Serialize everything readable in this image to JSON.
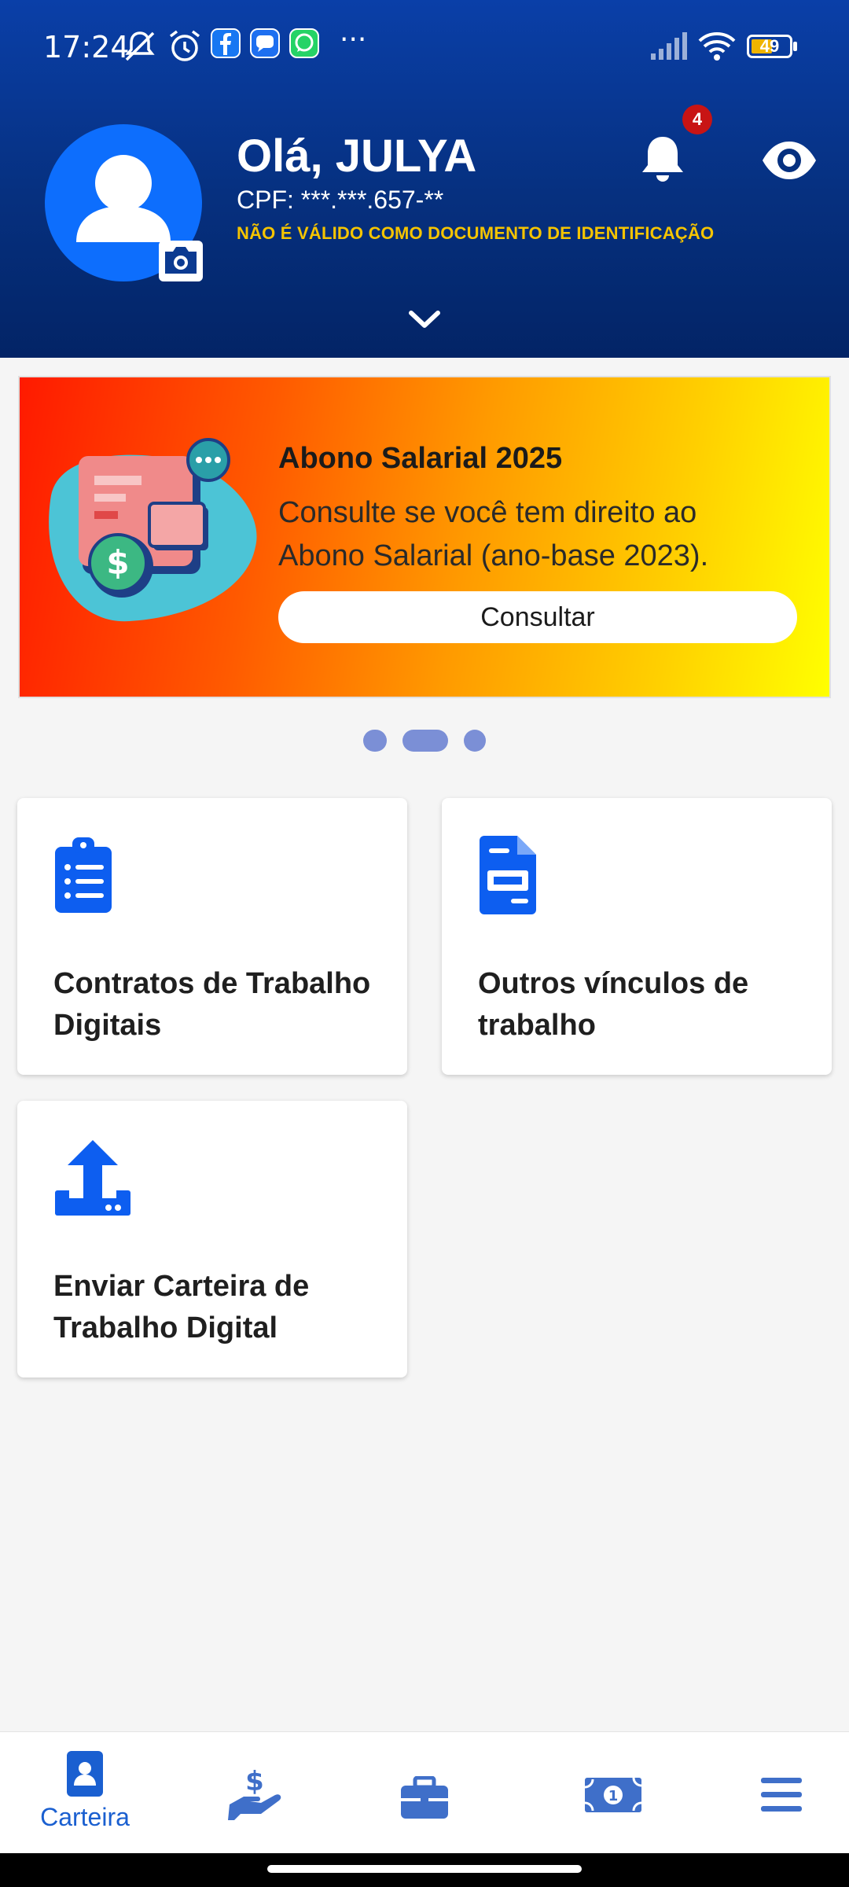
{
  "status_bar": {
    "time": "17:24",
    "battery": "49",
    "more": "···",
    "icons": [
      "bell-muted-icon",
      "alarm-icon",
      "facebook-icon",
      "messenger-icon",
      "whatsapp-icon",
      "signal-icon",
      "wifi-icon",
      "battery-icon"
    ]
  },
  "header": {
    "greeting": "Olá, JULYA",
    "cpf": "CPF: ***.***.657-**",
    "notice": "NÃO É VÁLIDO COMO DOCUMENTO DE IDENTIFICAÇÃO",
    "notification_count": "4"
  },
  "banner": {
    "title": "Abono Salarial 2025",
    "text": "Consulte se você tem direito ao Abono Salarial (ano-base 2023).",
    "button_label": "Consultar"
  },
  "carousel": {
    "pages": 3,
    "active_index": 1
  },
  "cards": [
    {
      "label": "Contratos de Trabalho Digitais",
      "icon": "clipboard-list-icon"
    },
    {
      "label": "Outros vínculos de trabalho",
      "icon": "document-icon"
    },
    {
      "label": "Enviar Carteira de Trabalho Digital",
      "icon": "upload-icon"
    }
  ],
  "bottom_nav": {
    "items": [
      {
        "label": "Carteira",
        "icon": "wallet-id-icon",
        "active": true
      },
      {
        "label": "",
        "icon": "hand-money-icon"
      },
      {
        "label": "",
        "icon": "briefcase-icon"
      },
      {
        "label": "",
        "icon": "banknote-icon"
      },
      {
        "label": "",
        "icon": "menu-icon"
      }
    ]
  },
  "colors": {
    "header_top": "#0a3fa8",
    "header_bottom": "#032466",
    "accent_blue": "#0d5ef0",
    "notice_yellow": "#f5c400",
    "badge_red": "#c81414"
  }
}
